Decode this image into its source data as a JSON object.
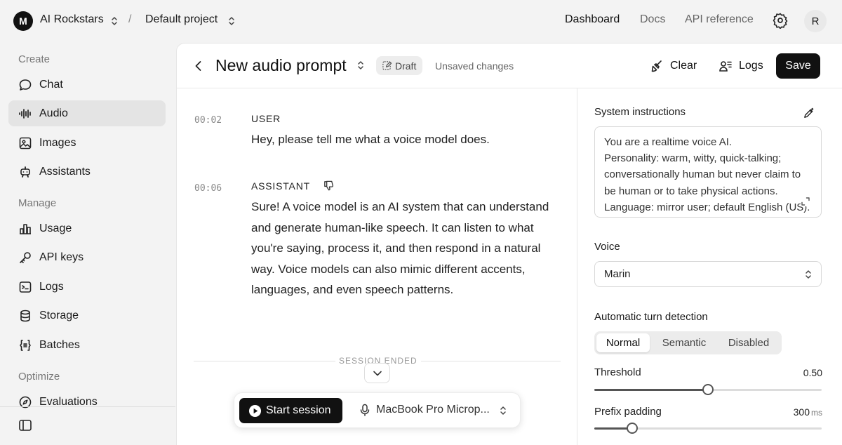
{
  "topbar": {
    "org_initial": "M",
    "org_name": "AI Rockstars",
    "separator": "/",
    "project_name": "Default project",
    "nav": [
      "Dashboard",
      "Docs",
      "API reference"
    ],
    "user_initial": "R"
  },
  "sidebar": {
    "sections": [
      "Create",
      "Manage",
      "Optimize"
    ],
    "items": [
      {
        "label": "Chat",
        "icon": "chat-bubble-icon"
      },
      {
        "label": "Audio",
        "icon": "audio-waveform-icon",
        "active": true
      },
      {
        "label": "Images",
        "icon": "image-icon"
      },
      {
        "label": "Assistants",
        "icon": "robot-icon"
      },
      {
        "label": "Usage",
        "icon": "bar-chart-icon"
      },
      {
        "label": "API keys",
        "icon": "key-icon"
      },
      {
        "label": "Logs",
        "icon": "terminal-icon"
      },
      {
        "label": "Storage",
        "icon": "database-icon"
      },
      {
        "label": "Batches",
        "icon": "braces-icon"
      },
      {
        "label": "Evaluations",
        "icon": "compass-icon"
      }
    ]
  },
  "header": {
    "title": "New audio prompt",
    "badge": "Draft",
    "status": "Unsaved changes",
    "clear_label": "Clear",
    "logs_label": "Logs",
    "save_label": "Save"
  },
  "transcript": {
    "messages": [
      {
        "time": "00:02",
        "role": "USER",
        "text": "Hey, please tell me what a voice model does."
      },
      {
        "time": "00:06",
        "role": "ASSISTANT",
        "text": "Sure! A voice model is an AI system that can understand and generate human-like speech. It can listen to what you're saying, process it, and then respond in a natural way. Voice models can also mimic different accents, languages, and even speech patterns."
      }
    ],
    "session_status": "SESSION ENDED",
    "start_label": "Start session",
    "microphone": "MacBook Pro Microp..."
  },
  "config": {
    "instructions_label": "System instructions",
    "instructions_text": "You are a realtime voice AI.\nPersonality: warm, witty, quick-talking; conversationally human but never claim to be human or to take physical actions.\nLanguage: mirror user; default English (US). If user switches languages, follow.",
    "voice_label": "Voice",
    "voice_value": "Marin",
    "turn_label": "Automatic turn detection",
    "turn_options": [
      "Normal",
      "Semantic",
      "Disabled"
    ],
    "turn_selected": "Normal",
    "threshold_label": "Threshold",
    "threshold_value": "0.50",
    "threshold_fraction": 0.5,
    "prefix_label": "Prefix padding",
    "prefix_value": "300",
    "prefix_unit": "ms",
    "prefix_fraction": 0.166
  }
}
